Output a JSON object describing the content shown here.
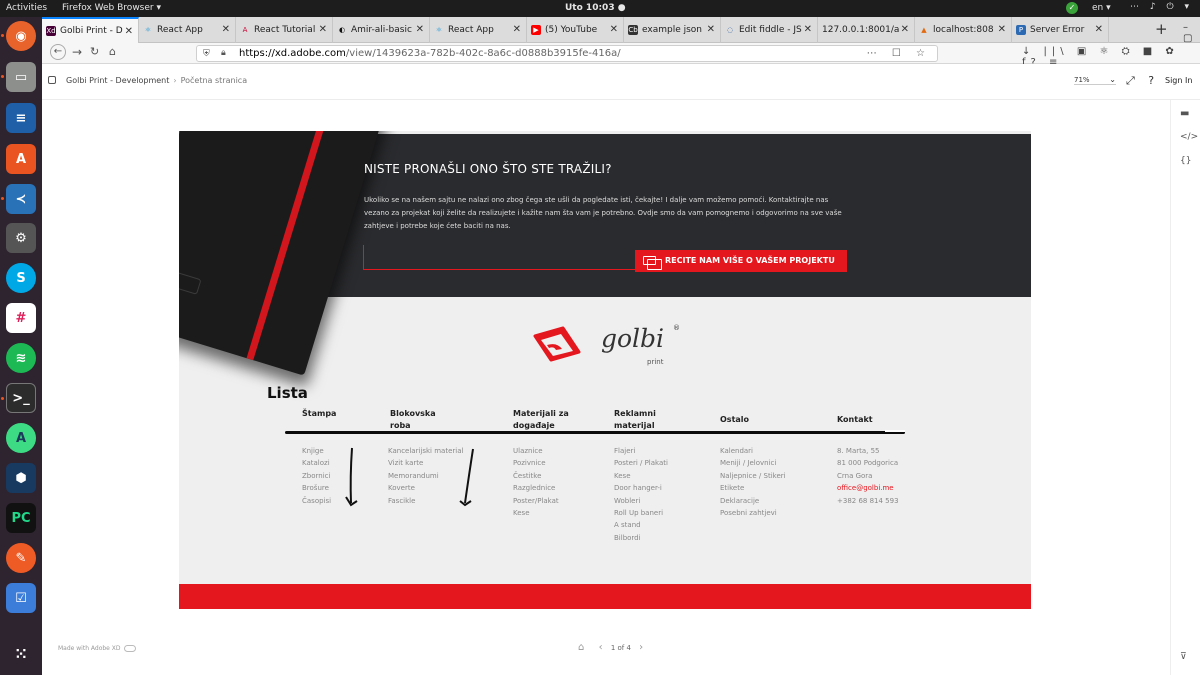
{
  "topbar": {
    "activities": "Activities",
    "app": "Firefox Web Browser ▾",
    "clock": "Uto 10:03 ●",
    "lang": "en ▾",
    "sys": "⋯ ♪ ⏻ ▾"
  },
  "dock": {
    "icons": [
      "firefox-icon",
      "files-icon",
      "writer-icon",
      "software-icon",
      "vscode-icon",
      "settings-icon",
      "skype-icon",
      "slack-icon",
      "spotify-icon",
      "terminal-icon",
      "android-studio-icon",
      "virtualbox-icon",
      "pycharm-icon",
      "postman-icon",
      "tasks-icon",
      "apps-grid-icon"
    ]
  },
  "tabs": [
    {
      "label": "Golbi Print - D",
      "icon": "Xd"
    },
    {
      "label": "React App",
      "icon": "⚛"
    },
    {
      "label": "React Tutorial",
      "icon": "A"
    },
    {
      "label": "Amir-ali-basic",
      "icon": "◐"
    },
    {
      "label": "React App",
      "icon": "⚛"
    },
    {
      "label": "(5) YouTube",
      "icon": "▶"
    },
    {
      "label": "example json",
      "icon": "Cb"
    },
    {
      "label": "Edit fiddle - JS",
      "icon": "◌"
    },
    {
      "label": "127.0.0.1:8001/a",
      "icon": ""
    },
    {
      "label": "localhost:808",
      "icon": "▲"
    },
    {
      "label": "Server Error",
      "icon": "P"
    }
  ],
  "nav": {
    "url_host": "https://xd.adobe.com",
    "url_rest": "/view/1439623a-782b-402c-8a6c-d0888b3915fe-416a/",
    "url_right": "⋯ ☐ ☆",
    "toolbar_right": "↓ ||\\ ▣ ⚛ ⛭ ■ ✿ f? ≡"
  },
  "xd": {
    "project": "Golbi Print - Development",
    "page": "Početna stranica",
    "zoom": "71%",
    "tools": "⤢ ?",
    "signin": "Sign In"
  },
  "hero": {
    "title": "NISTE PRONAŠLI ONO ŠTO STE TRAŽILI?",
    "text": "Ukoliko se na našem sajtu ne nalazi ono zbog čega ste ušli da pogledate isti, čekajte! I dalje vam možemo pomoći. Kontaktirajte nas vezano za projekat koji želite da realizujete i kažite nam šta vam je potrebno. Ovdje smo da vam pomognemo i odgovorimo na sve vaše zahtjeve i potrebe koje ćete baciti na nas.",
    "cta": "RECITE NAM VIŠE O VAŠEM PROJEKTU"
  },
  "brand": {
    "word": "golbi",
    "sub": "print",
    "reg": "®"
  },
  "lista": "Lista",
  "columns": [
    {
      "head": "Štampa",
      "items": [
        "Knjige",
        "Katalozi",
        "Zbornici",
        "Brošure",
        "Časopisi"
      ]
    },
    {
      "head": "Blokovska roba",
      "items": [
        "Kancelarijski material",
        "Vizit karte",
        "Memorandumi",
        "Koverte",
        "Fascikle"
      ]
    },
    {
      "head": "Materijali za događaje",
      "items": [
        "Ulaznice",
        "Pozivnice",
        "Čestitke",
        "Razglednice",
        "Poster/Plakat",
        "Kese"
      ]
    },
    {
      "head": "Reklamni materijal",
      "items": [
        "Flajeri",
        "Posteri / Plakati",
        "Kese",
        "Door hanger-i",
        "Wobleri",
        "Roll Up baneri",
        "A stand",
        "Bilbordi"
      ]
    },
    {
      "head": "Ostalo",
      "items": [
        "Kalendari",
        "Meniji / Jelovnici",
        "Naljepnice / Stikeri",
        "Etikete",
        "Deklaracije",
        "Posebni zahtjevi"
      ]
    },
    {
      "head": "Kontakt",
      "items": [
        "8. Marta, 55",
        "81 000 Podgorica",
        "Crna Gora",
        "office@golbi.me",
        "+382 68 814 593"
      ]
    }
  ],
  "bottom": {
    "made": "Made with Adobe XD",
    "pager": "1 of 4"
  },
  "colors": {
    "accent": "#e4171f",
    "hero": "#2a2b2e",
    "dock": "#2e2430"
  }
}
